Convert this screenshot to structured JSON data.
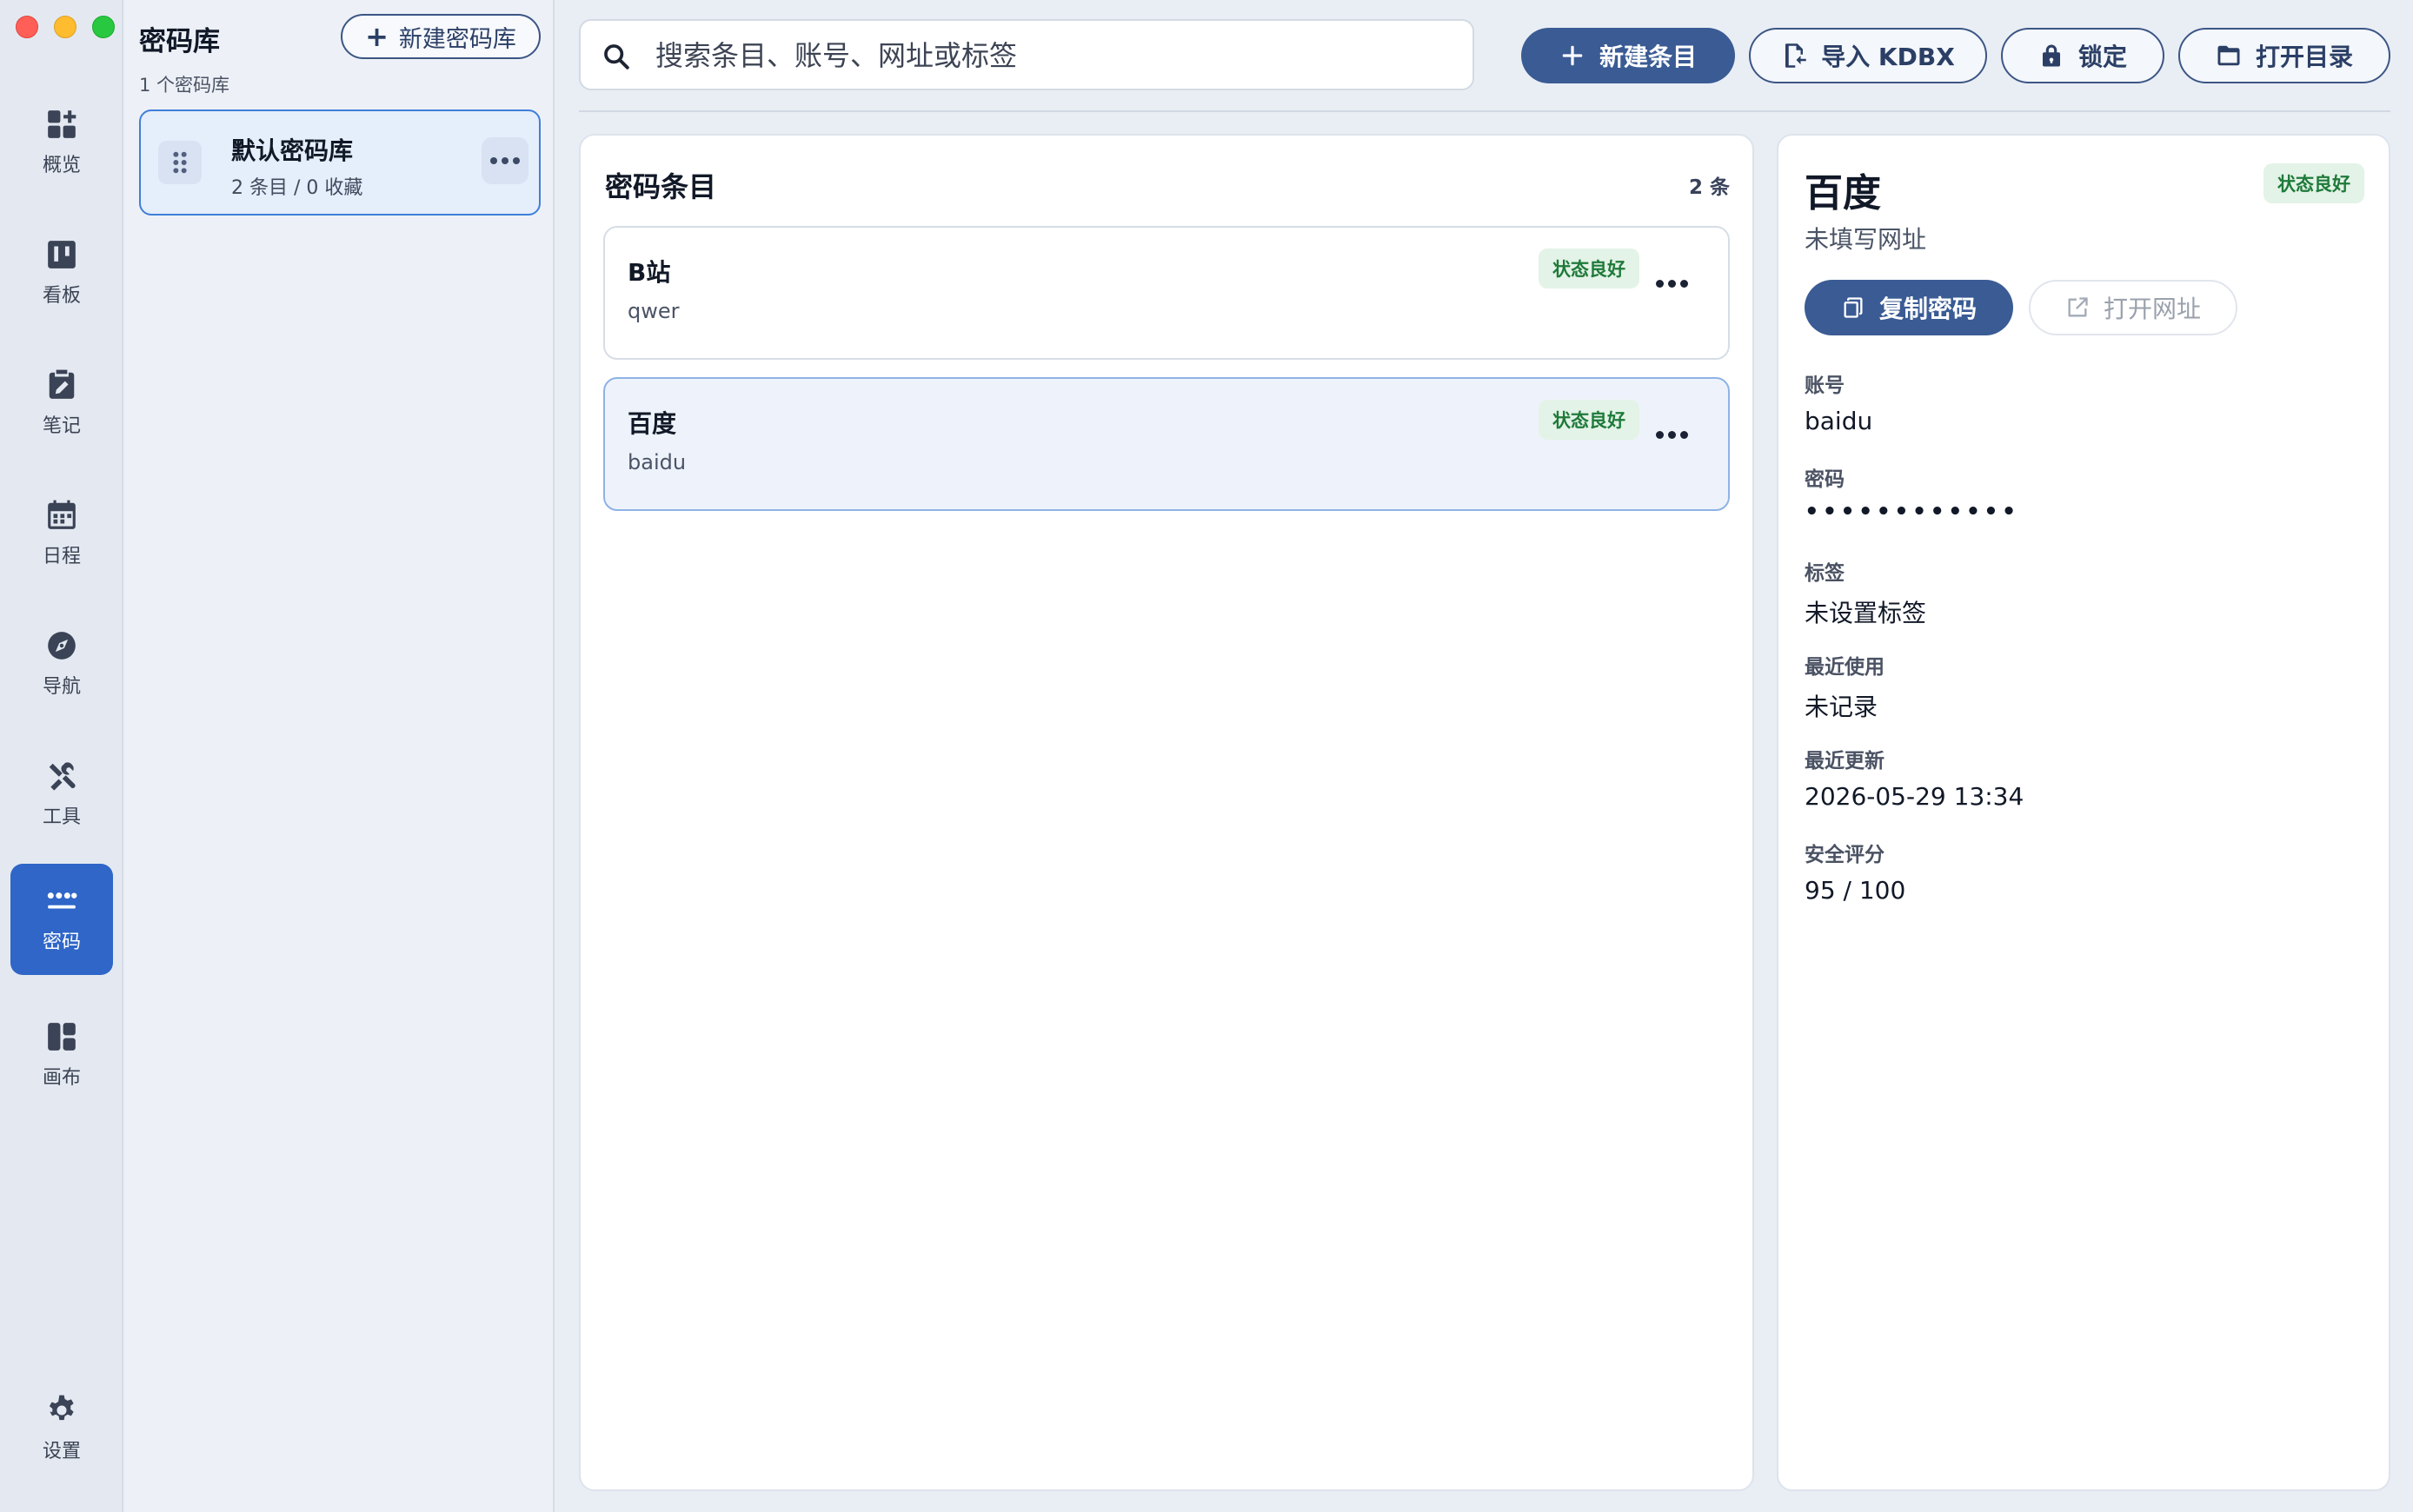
{
  "window": {
    "controls": [
      "close",
      "minimize",
      "zoom"
    ]
  },
  "nav": {
    "items": [
      {
        "label": "概览",
        "icon": "dashboard-add-icon"
      },
      {
        "label": "看板",
        "icon": "kanban-icon"
      },
      {
        "label": "笔记",
        "icon": "note-edit-icon"
      },
      {
        "label": "日程",
        "icon": "calendar-icon"
      },
      {
        "label": "导航",
        "icon": "compass-icon"
      },
      {
        "label": "工具",
        "icon": "tools-icon"
      },
      {
        "label": "密码",
        "icon": "password-icon",
        "active": true
      },
      {
        "label": "画布",
        "icon": "canvas-layout-icon"
      }
    ],
    "settings": {
      "label": "设置",
      "icon": "gear-icon"
    }
  },
  "vaults": {
    "title": "密码库",
    "count": "1 个密码库",
    "new_button": "新建密码库",
    "items": [
      {
        "name": "默认密码库",
        "stats": "2 条目 / 0 收藏",
        "selected": true
      }
    ]
  },
  "toolbar": {
    "search_placeholder": "搜索条目、账号、网址或标签",
    "new_entry": "新建条目",
    "import": "导入 KDBX",
    "lock": "锁定",
    "open_dir": "打开目录"
  },
  "entries": {
    "title": "密码条目",
    "count": "2 条",
    "items": [
      {
        "name": "B站",
        "username": "qwer",
        "status": "状态良好",
        "selected": false
      },
      {
        "name": "百度",
        "username": "baidu",
        "status": "状态良好",
        "selected": true
      }
    ]
  },
  "detail": {
    "title": "百度",
    "status": "状态良好",
    "url": "未填写网址",
    "copy_button": "复制密码",
    "open_button": "打开网址",
    "fields": {
      "account": {
        "label": "账号",
        "value": "baidu"
      },
      "password": {
        "label": "密码",
        "value": "••••••••••••"
      },
      "tags": {
        "label": "标签",
        "value": "未设置标签"
      },
      "last_used": {
        "label": "最近使用",
        "value": "未记录"
      },
      "updated": {
        "label": "最近更新",
        "value": "2026-05-29 13:34"
      },
      "score": {
        "label": "安全评分",
        "value": "95 / 100"
      }
    }
  },
  "colors": {
    "accent": "#2f66c8",
    "primary_button": "#3a5b94",
    "status_good_bg": "#e3f3e7",
    "status_good_text": "#1f7a3a"
  }
}
